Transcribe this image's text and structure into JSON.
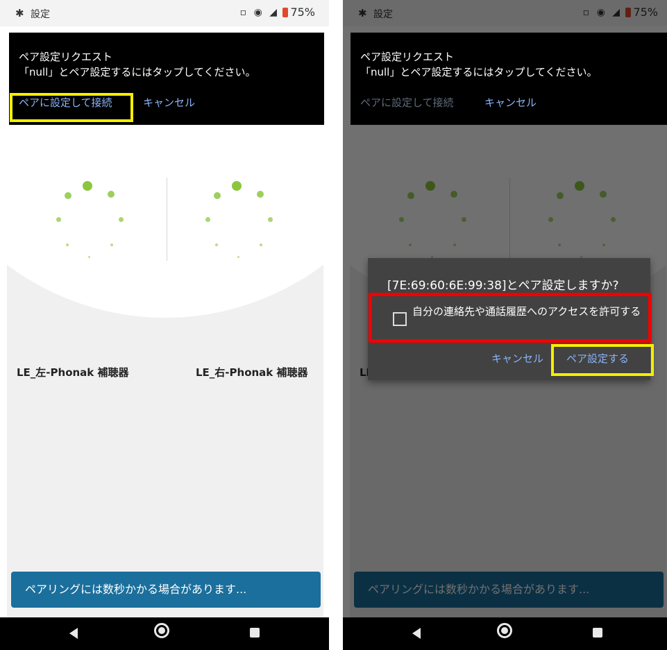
{
  "statusbar": {
    "bt_icon": "bluetooth-icon",
    "title": "設定",
    "icons": "vibrate wifi signal",
    "battery": "75%"
  },
  "notification": {
    "title": "ペア設定リクエスト",
    "body": "「null」とペア設定するにはタップしてください。",
    "action_pair": "ペアに設定して接続",
    "action_cancel": "キャンセル"
  },
  "devices": {
    "left_name": "LE_左-Phonak 補聴器",
    "right_name": "LE_右-Phonak 補聴器"
  },
  "banner": {
    "text": "ペアリングには数秒かかる場合があります..."
  },
  "dialog": {
    "title": "[7E:69:60:6E:99:38]とペア設定しますか?",
    "checkbox_label": "自分の連絡先や通話履歴へのアクセスを許可する",
    "cancel": "キャンセル",
    "pair": "ペア設定する"
  },
  "colors": {
    "accent_green": "#8cc63f",
    "banner_blue": "#1b6f9c",
    "highlight_yellow": "#f5ef00",
    "highlight_red": "#f20000"
  }
}
